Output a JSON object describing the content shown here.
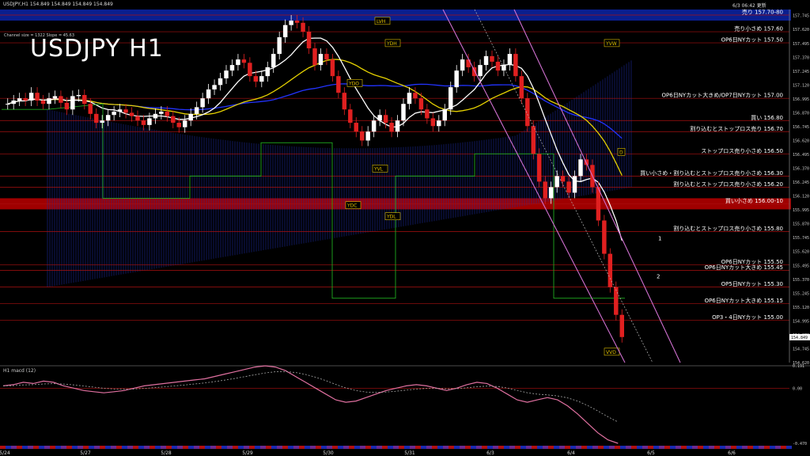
{
  "header": {
    "symbol_info": "USDJPY,H1  154.849 154.849 154.849 154.849",
    "datetime": "6/3 06:42 更新",
    "channel_info": "Channel size = 1322  Slope = 45.63",
    "big_title": "USDJPY H1"
  },
  "indicator_label": "H1  macd (12)",
  "colors": {
    "background": "#000000",
    "sell_zone": "#0a1f8f",
    "buy_zone": "#a00000",
    "cloud": "#1d2fa8",
    "candle_up": "#ffffff",
    "candle_down": "#e02020",
    "ema_fast": "#ffffff",
    "ema_mid": "#e6d200",
    "ema_slow": "#2233ff",
    "green_line": "#1faa1f",
    "channel": "#d070d0",
    "macd": "#e070a0",
    "signal": "#aaaaaa"
  },
  "chart_data": {
    "type": "candlestick",
    "title": "USDJPY H1",
    "ylim": [
      154.62,
      157.8
    ],
    "y_ticks": [
      157.745,
      157.62,
      157.495,
      157.37,
      157.245,
      157.12,
      156.995,
      156.87,
      156.745,
      156.62,
      156.495,
      156.37,
      156.245,
      156.12,
      155.995,
      155.87,
      155.745,
      155.62,
      155.495,
      155.37,
      155.245,
      155.12,
      154.995,
      154.87,
      154.745,
      154.62
    ],
    "current_price": 154.849,
    "x_labels": [
      "5/24",
      "5/27",
      "5/28",
      "5/29",
      "5/30",
      "5/31",
      "6/3",
      "6/4",
      "6/5",
      "6/6"
    ],
    "close_path": [
      156.95,
      156.98,
      157.0,
      156.98,
      157.05,
      156.98,
      156.95,
      157.0,
      157.02,
      156.96,
      156.9,
      157.02,
      157.03,
      156.95,
      156.86,
      156.78,
      156.8,
      156.85,
      156.88,
      156.9,
      156.87,
      156.84,
      156.8,
      156.76,
      156.82,
      156.86,
      156.88,
      156.84,
      156.78,
      156.74,
      156.8,
      156.86,
      156.92,
      157.0,
      157.08,
      157.12,
      157.18,
      157.25,
      157.3,
      157.35,
      157.32,
      157.2,
      157.15,
      157.2,
      157.28,
      157.4,
      157.55,
      157.66,
      157.7,
      157.68,
      157.6,
      157.45,
      157.3,
      157.4,
      157.35,
      157.2,
      157.05,
      156.9,
      156.78,
      156.7,
      156.62,
      156.7,
      156.8,
      156.85,
      156.78,
      156.7,
      156.8,
      156.95,
      157.05,
      157.0,
      156.9,
      156.82,
      156.75,
      156.8,
      156.9,
      157.1,
      157.25,
      157.35,
      157.28,
      157.2,
      157.3,
      157.38,
      157.33,
      157.25,
      157.3,
      157.4,
      157.2,
      157.0,
      156.75,
      156.5,
      156.25,
      156.1,
      156.2,
      156.3,
      156.25,
      156.15,
      156.3,
      156.45,
      156.4,
      156.2,
      155.9,
      155.6,
      155.3,
      155.05,
      154.85
    ],
    "reference_levels": [
      {
        "label": "売り 157.70-80",
        "value": 157.75
      },
      {
        "label": "売り小さめ 157.60",
        "value": 157.6
      },
      {
        "label": "OP6日NYカット 157.50",
        "value": 157.5
      },
      {
        "label": "OP6日NYカット大きめ/OP7日NYカット 157.00",
        "value": 157.0
      },
      {
        "label": "買い 156.80",
        "value": 156.8
      },
      {
        "label": "割り込むとストップロス売り 156.70",
        "value": 156.7
      },
      {
        "label": "ストップロス売り小さめ 156.50",
        "value": 156.5
      },
      {
        "label": "買い小さめ・割り込むとストップロス売り小さめ 156.30",
        "value": 156.3
      },
      {
        "label": "割り込むとストップロス売り小さめ 156.20",
        "value": 156.2
      },
      {
        "label": "買い小さめ 156.00-10",
        "value": 156.05
      },
      {
        "label": "割り込むとストップロス売り小さめ 155.80",
        "value": 155.8
      },
      {
        "label": "OP6日NYカット 155.50",
        "value": 155.5
      },
      {
        "label": "OP6日NYカット大きめ 155.45",
        "value": 155.45
      },
      {
        "label": "OP5日NYカット 155.30",
        "value": 155.3
      },
      {
        "label": "OP6日NYカット大きめ 155.15",
        "value": 155.15
      },
      {
        "label": "OP3・4日NYカット 155.00",
        "value": 155.0
      }
    ],
    "marker_labels": {
      "lvh": "LVH",
      "ydh": "YDH",
      "yvw": "YVW",
      "ydo": "YDO",
      "yvl": "YVL",
      "ydc": "YDC",
      "ydl": "YDL",
      "d": "D",
      "vvd": "VVD"
    },
    "channel_annotations": [
      "1",
      "2"
    ],
    "macd_ticks": [
      "0.191",
      "0.00",
      "-0.470"
    ],
    "macd_values": [
      0.02,
      0.03,
      0.05,
      0.04,
      0.06,
      0.05,
      0.02,
      0.0,
      -0.02,
      -0.03,
      -0.04,
      -0.03,
      -0.02,
      0.0,
      0.02,
      0.03,
      0.04,
      0.05,
      0.06,
      0.07,
      0.08,
      0.1,
      0.12,
      0.14,
      0.16,
      0.18,
      0.19,
      0.18,
      0.15,
      0.1,
      0.05,
      0.0,
      -0.05,
      -0.1,
      -0.12,
      -0.11,
      -0.08,
      -0.05,
      -0.02,
      0.0,
      0.02,
      0.03,
      0.02,
      0.0,
      -0.02,
      0.0,
      0.03,
      0.05,
      0.04,
      0.0,
      -0.05,
      -0.1,
      -0.12,
      -0.1,
      -0.08,
      -0.1,
      -0.15,
      -0.22,
      -0.3,
      -0.38,
      -0.44,
      -0.47
    ]
  }
}
